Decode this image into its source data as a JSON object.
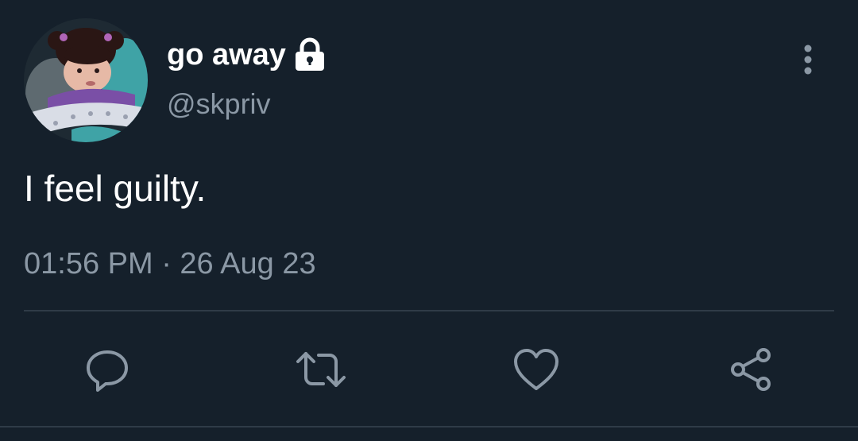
{
  "user": {
    "display_name": "go away",
    "handle": "@skpriv",
    "protected_icon": "lock-icon"
  },
  "tweet": {
    "text": "I feel guilty.",
    "timestamp": "01:56 PM · 26 Aug 23"
  },
  "actions": [
    "reply-icon",
    "retweet-icon",
    "like-icon",
    "share-icon"
  ],
  "colors": {
    "background": "#15202b",
    "primary_text": "#ffffff",
    "secondary_text": "#8b98a5",
    "divider": "#2f3b47"
  }
}
